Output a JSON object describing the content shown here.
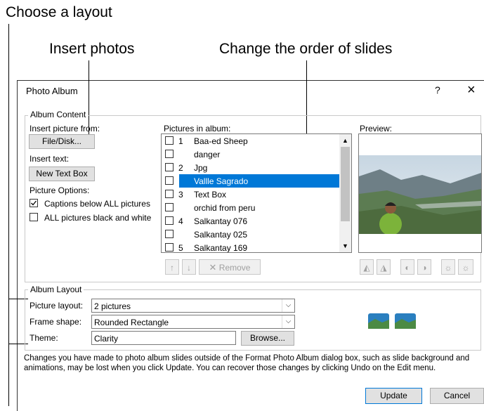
{
  "callouts": {
    "choose_layout": "Choose a layout",
    "insert_photos": "Insert photos",
    "change_order": "Change the order of slides"
  },
  "dialog": {
    "title": "Photo Album",
    "help": "?",
    "close": "×",
    "album_content": {
      "group_label": "Album Content",
      "insert_from_label": "Insert picture from:",
      "file_disk_button": "File/Disk...",
      "insert_text_label": "Insert text:",
      "new_text_box_button": "New Text Box",
      "picture_options_label": "Picture Options:",
      "captions_below_label": "Captions below ALL pictures",
      "captions_below_checked": true,
      "black_white_label": "ALL pictures black and white",
      "black_white_checked": false,
      "pictures_label": "Pictures in album:",
      "pictures": [
        {
          "num": "1",
          "name": "Baa-ed Sheep",
          "selected": false
        },
        {
          "num": "",
          "name": "danger",
          "selected": false
        },
        {
          "num": "2",
          "name": "Jpg",
          "selected": false
        },
        {
          "num": "",
          "name": "Vallle Sagrado",
          "selected": true
        },
        {
          "num": "3",
          "name": "Text Box",
          "selected": false
        },
        {
          "num": "",
          "name": "orchid from peru",
          "selected": false
        },
        {
          "num": "4",
          "name": "Salkantay 076",
          "selected": false
        },
        {
          "num": "",
          "name": "Salkantay 025",
          "selected": false
        },
        {
          "num": "5",
          "name": "Salkantay 169",
          "selected": false
        }
      ],
      "preview_label": "Preview:",
      "move_up": "↑",
      "move_down": "↓",
      "remove_button": "Remove"
    },
    "album_layout": {
      "group_label": "Album Layout",
      "picture_layout_label": "Picture layout:",
      "picture_layout_value": "2 pictures",
      "frame_shape_label": "Frame shape:",
      "frame_shape_value": "Rounded Rectangle",
      "theme_label": "Theme:",
      "theme_value": "Clarity",
      "browse_button": "Browse..."
    },
    "notice": "Changes you have made to photo album slides outside of the Format Photo Album dialog box, such as slide background and animations, may be lost when you click Update. You can recover those changes by clicking Undo on the Edit menu.",
    "update_button": "Update",
    "cancel_button": "Cancel"
  }
}
